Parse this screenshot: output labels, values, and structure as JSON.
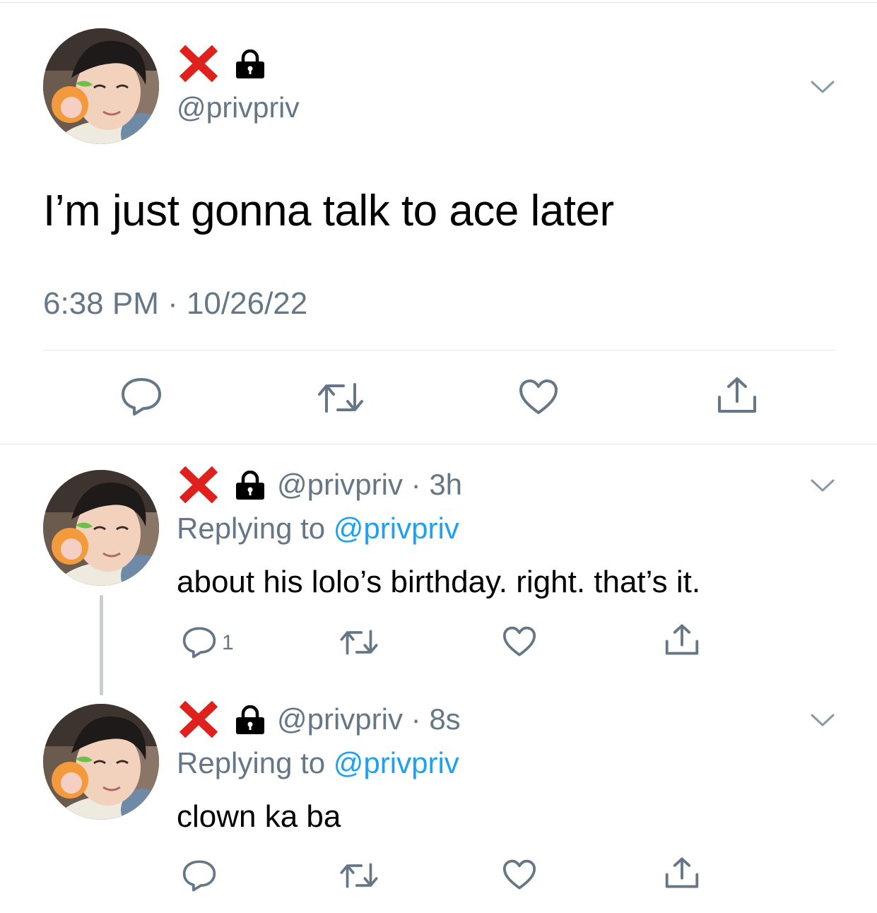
{
  "main_tweet": {
    "handle": "@privpriv",
    "text": "I’m just gonna talk to ace later",
    "timestamp": "6:38 PM · 10/26/22"
  },
  "replies": [
    {
      "handle": "@privpriv",
      "time": "· 3h",
      "replying_prefix": "Replying to ",
      "replying_handle": "@privpriv",
      "text": "about his lolo’s birthday. right. that’s it.",
      "reply_count": "1"
    },
    {
      "handle": "@privpriv",
      "time": "· 8s",
      "replying_prefix": "Replying to ",
      "replying_handle": "@privpriv",
      "text": "clown ka ba",
      "reply_count": ""
    }
  ],
  "icons": {
    "name_emoji": "cross-mark-icon",
    "protected": "lock-icon",
    "menu": "chevron-down-icon",
    "reply": "reply-icon",
    "retweet": "retweet-icon",
    "like": "heart-icon",
    "share": "share-icon"
  },
  "colors": {
    "secondary_text": "#657786",
    "mention": "#1da1f2",
    "cross": "#e0201d",
    "divider": "#e1e8ed",
    "thread_line": "#c4cfd6"
  }
}
